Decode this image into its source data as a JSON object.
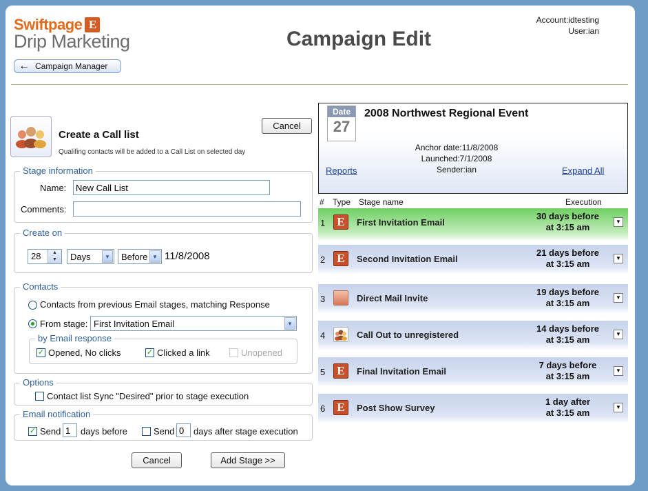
{
  "header": {
    "logo_brand": "Swiftpage",
    "logo_letter": "E",
    "logo_product": "Drip Marketing",
    "back_label": "Campaign Manager",
    "title": "Campaign Edit",
    "account_line": "Account:idtesting",
    "user_line": "User:ian"
  },
  "stage_form": {
    "title": "Create a Call list",
    "subtitle": "Qualifing contacts will be added to a Call List on selected day",
    "cancel_top": "Cancel",
    "stage_info": {
      "legend": "Stage information",
      "name_label": "Name:",
      "name_value": "New Call List",
      "comments_label": "Comments:",
      "comments_value": ""
    },
    "create_on": {
      "legend": "Create on",
      "offset_value": "28",
      "unit_value": "Days",
      "direction_value": "Before",
      "date": "11/8/2008"
    },
    "contacts": {
      "legend": "Contacts",
      "option1": "Contacts from previous Email stages, matching Response",
      "option2": "From stage:",
      "from_stage_value": "First Invitation Email",
      "response_legend": "by Email response",
      "opened": "Opened, No clicks",
      "clicked": "Clicked a link",
      "unopened": "Unopened"
    },
    "options": {
      "legend": "Options",
      "sync_label": "Contact list Sync \"Desired\" prior to stage execution"
    },
    "notification": {
      "legend": "Email notification",
      "send1": "Send",
      "before_value": "1",
      "before_text": "days before",
      "send2": "Send",
      "after_value": "0",
      "after_text": "days after stage execution"
    },
    "cancel_bottom": "Cancel",
    "add_stage": "Add Stage >>"
  },
  "event": {
    "calendar_header": "Date",
    "calendar_day": "27",
    "title": "2008 Northwest Regional Event",
    "anchor": "Anchor date:11/8/2008",
    "launched": "Launched:7/1/2008",
    "sender": "Sender:ian",
    "reports": "Reports",
    "expand_all": "Expand All"
  },
  "stages_header": {
    "num": "#",
    "type": "Type",
    "name": "Stage name",
    "execution": "Execution"
  },
  "stages": [
    {
      "num": "1",
      "type_icon": "email-icon",
      "name": "First Invitation Email",
      "exec1": "30 days before",
      "exec2": "at 3:15 am"
    },
    {
      "num": "2",
      "type_icon": "email-icon",
      "name": "Second Invitation Email",
      "exec1": "21 days before",
      "exec2": "at 3:15 am"
    },
    {
      "num": "3",
      "type_icon": "direct-mail-icon",
      "name": "Direct Mail Invite",
      "exec1": "19 days before",
      "exec2": "at 3:15 am"
    },
    {
      "num": "4",
      "type_icon": "call-list-icon",
      "name": "Call Out to unregistered",
      "exec1": "14 days before",
      "exec2": "at 3:15 am"
    },
    {
      "num": "5",
      "type_icon": "email-icon",
      "name": "Final Invitation Email",
      "exec1": "7 days before",
      "exec2": "at 3:15 am"
    },
    {
      "num": "6",
      "type_icon": "email-icon",
      "name": "Post Show Survey",
      "exec1": "1 day after",
      "exec2": "at 3:15 am"
    }
  ],
  "colors": {
    "background": "#6f9bc7",
    "active_row": "#6fcf62",
    "row": "#c7d3ec",
    "brand_orange": "#e26a1b",
    "legend_blue": "#2e5f9c"
  }
}
